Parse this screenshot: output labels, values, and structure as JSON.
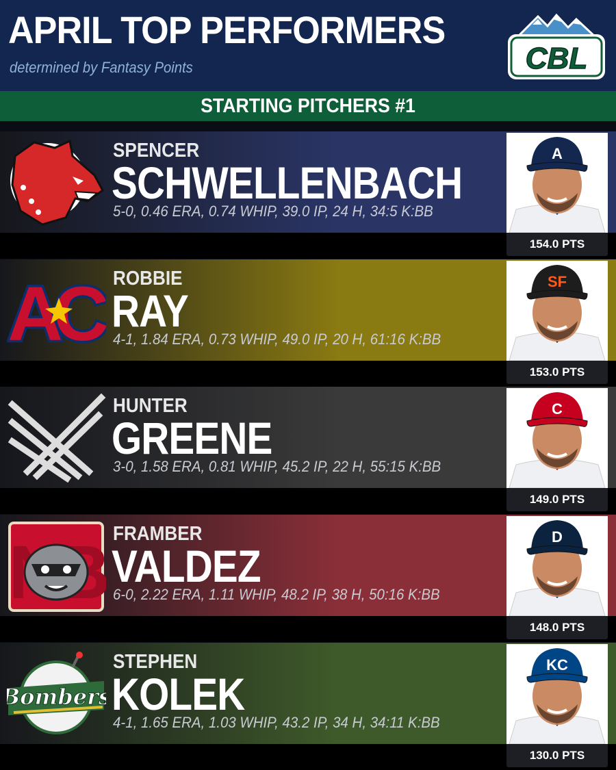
{
  "header": {
    "title": "APRIL TOP PERFORMERS",
    "subtitle": "determined by Fantasy Points",
    "logo_text": "CBL"
  },
  "section": {
    "label": "STARTING PITCHERS #1"
  },
  "players": [
    {
      "first": "SPENCER",
      "last": "SCHWELLENBACH",
      "stats": "5-0, 0.46 ERA, 0.74 WHIP, 39.0 IP, 24 H, 34:5 K:BB",
      "points": "154.0 PTS",
      "bg_color": "#2a3566",
      "team_logo": "red-wolf-logo",
      "cap_color": "#13274f",
      "cap_mark": "A",
      "cap_mark_color": "#ffffff"
    },
    {
      "first": "ROBBIE",
      "last": "RAY",
      "stats": "4-1, 1.84 ERA, 0.73 WHIP, 49.0 IP, 20 H, 61:16 K:BB",
      "points": "153.0 PTS",
      "bg_color": "#8a7a12",
      "team_logo": "AC",
      "cap_color": "#1d1d1d",
      "cap_mark": "SF",
      "cap_mark_color": "#fd5a1e"
    },
    {
      "first": "HUNTER",
      "last": "GREENE",
      "stats": "3-0, 1.58 ERA, 0.81 WHIP, 45.2 IP, 22 H, 55:15 K:BB",
      "points": "149.0 PTS",
      "bg_color": "#3a3a3a",
      "team_logo": "crossed-wings-logo",
      "cap_color": "#c6011f",
      "cap_mark": "C",
      "cap_mark_color": "#ffffff"
    },
    {
      "first": "FRAMBER",
      "last": "VALDEZ",
      "stats": "6-0, 2.22 ERA, 1.11 WHIP, 48.2 IP, 38 H, 50:16 K:BB",
      "points": "148.0 PTS",
      "bg_color": "#8a2f38",
      "team_logo": "NB",
      "cap_color": "#0c2340",
      "cap_mark": "D",
      "cap_mark_color": "#ffffff"
    },
    {
      "first": "STEPHEN",
      "last": "KOLEK",
      "stats": "4-1, 1.65 ERA, 1.03 WHIP, 43.2 IP, 34 H, 34:11 K:BB",
      "points": "130.0 PTS",
      "bg_color": "#3f5a2a",
      "team_logo": "Bombers",
      "cap_color": "#004687",
      "cap_mark": "KC",
      "cap_mark_color": "#ffffff"
    }
  ]
}
